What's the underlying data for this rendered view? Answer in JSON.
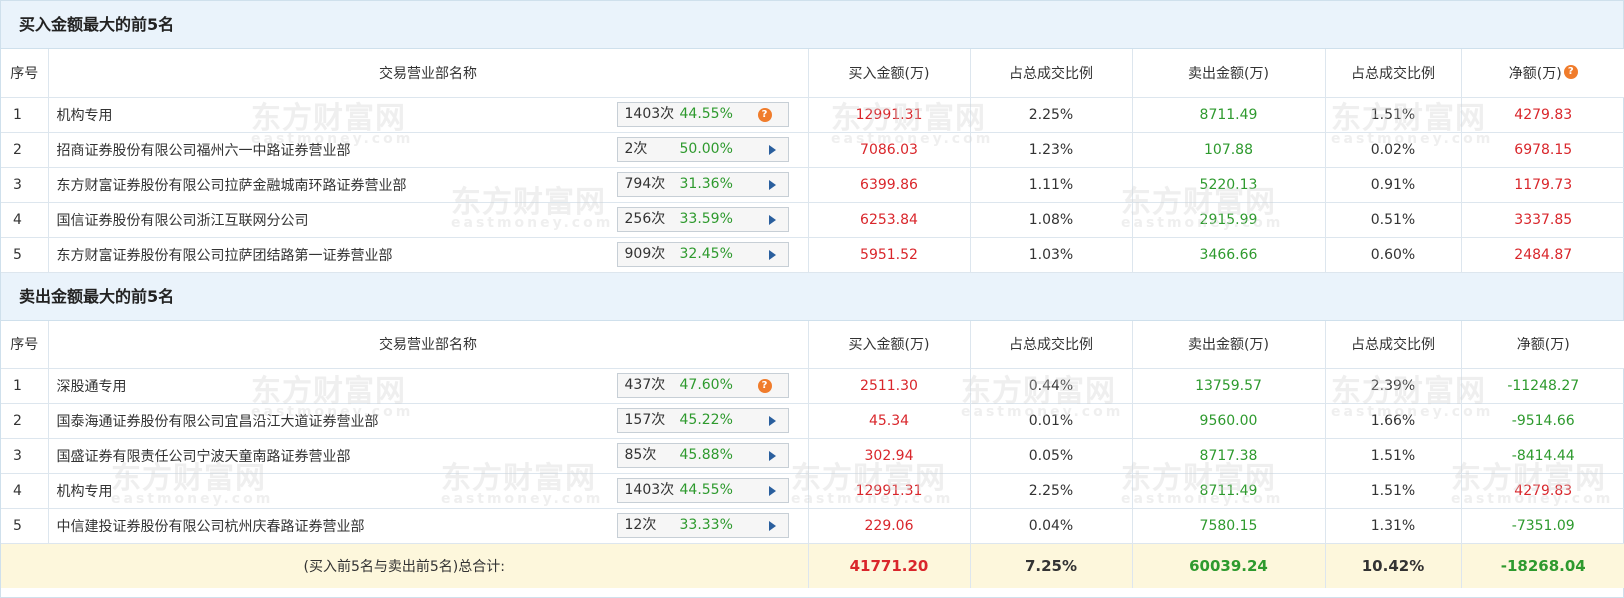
{
  "buy_section": {
    "title": "买入金额最大的前5名",
    "headers": [
      "序号",
      "交易营业部名称",
      "买入金额(万)",
      "占总成交比例",
      "卖出金额(万)",
      "占总成交比例",
      "净额(万)"
    ],
    "rows": [
      {
        "idx": "1",
        "name": "机构专用",
        "count": "1403次",
        "pct": "44.55%",
        "icon": "question-icon",
        "buy": "12991.31",
        "buy_ratio": "2.25%",
        "sell": "8711.49",
        "sell_ratio": "1.51%",
        "net": "4279.83"
      },
      {
        "idx": "2",
        "name": "招商证券股份有限公司福州六一中路证券营业部",
        "count": "2次",
        "pct": "50.00%",
        "icon": "arrow-right-icon",
        "buy": "7086.03",
        "buy_ratio": "1.23%",
        "sell": "107.88",
        "sell_ratio": "0.02%",
        "net": "6978.15"
      },
      {
        "idx": "3",
        "name": "东方财富证券股份有限公司拉萨金融城南环路证券营业部",
        "count": "794次",
        "pct": "31.36%",
        "icon": "arrow-right-icon",
        "buy": "6399.86",
        "buy_ratio": "1.11%",
        "sell": "5220.13",
        "sell_ratio": "0.91%",
        "net": "1179.73"
      },
      {
        "idx": "4",
        "name": "国信证券股份有限公司浙江互联网分公司",
        "count": "256次",
        "pct": "33.59%",
        "icon": "arrow-right-icon",
        "buy": "6253.84",
        "buy_ratio": "1.08%",
        "sell": "2915.99",
        "sell_ratio": "0.51%",
        "net": "3337.85"
      },
      {
        "idx": "5",
        "name": "东方财富证券股份有限公司拉萨团结路第一证券营业部",
        "count": "909次",
        "pct": "32.45%",
        "icon": "arrow-right-icon",
        "buy": "5951.52",
        "buy_ratio": "1.03%",
        "sell": "3466.66",
        "sell_ratio": "0.60%",
        "net": "2484.87"
      }
    ]
  },
  "sell_section": {
    "title": "卖出金额最大的前5名",
    "headers": [
      "序号",
      "交易营业部名称",
      "买入金额(万)",
      "占总成交比例",
      "卖出金额(万)",
      "占总成交比例",
      "净额(万)"
    ],
    "rows": [
      {
        "idx": "1",
        "name": "深股通专用",
        "count": "437次",
        "pct": "47.60%",
        "icon": "question-icon",
        "buy": "2511.30",
        "buy_ratio": "0.44%",
        "sell": "13759.57",
        "sell_ratio": "2.39%",
        "net": "-11248.27"
      },
      {
        "idx": "2",
        "name": "国泰海通证券股份有限公司宜昌沿江大道证券营业部",
        "count": "157次",
        "pct": "45.22%",
        "icon": "arrow-right-icon",
        "buy": "45.34",
        "buy_ratio": "0.01%",
        "sell": "9560.00",
        "sell_ratio": "1.66%",
        "net": "-9514.66"
      },
      {
        "idx": "3",
        "name": "国盛证券有限责任公司宁波天童南路证券营业部",
        "count": "85次",
        "pct": "45.88%",
        "icon": "arrow-right-icon",
        "buy": "302.94",
        "buy_ratio": "0.05%",
        "sell": "8717.38",
        "sell_ratio": "1.51%",
        "net": "-8414.44"
      },
      {
        "idx": "4",
        "name": "机构专用",
        "count": "1403次",
        "pct": "44.55%",
        "icon": "arrow-right-icon",
        "buy": "12991.31",
        "buy_ratio": "2.25%",
        "sell": "8711.49",
        "sell_ratio": "1.51%",
        "net": "4279.83"
      },
      {
        "idx": "5",
        "name": "中信建投证券股份有限公司杭州庆春路证券营业部",
        "count": "12次",
        "pct": "33.33%",
        "icon": "arrow-right-icon",
        "buy": "229.06",
        "buy_ratio": "0.04%",
        "sell": "7580.15",
        "sell_ratio": "1.31%",
        "net": "-7351.09"
      }
    ]
  },
  "total": {
    "label": "(买入前5名与卖出前5名)总合计:",
    "buy": "41771.20",
    "buy_ratio": "7.25%",
    "sell": "60039.24",
    "sell_ratio": "10.42%",
    "net": "-18268.04"
  },
  "watermark": {
    "text": "东方财富网",
    "sub": "eastmoney.com"
  },
  "colors": {
    "buy": "#d9262b",
    "sell": "#2e9a2e",
    "header_bg": "#eaf3fb",
    "total_bg": "#fdf7dc",
    "icon_orange": "#f07c2b",
    "arrow_blue": "#2a5f9e"
  }
}
